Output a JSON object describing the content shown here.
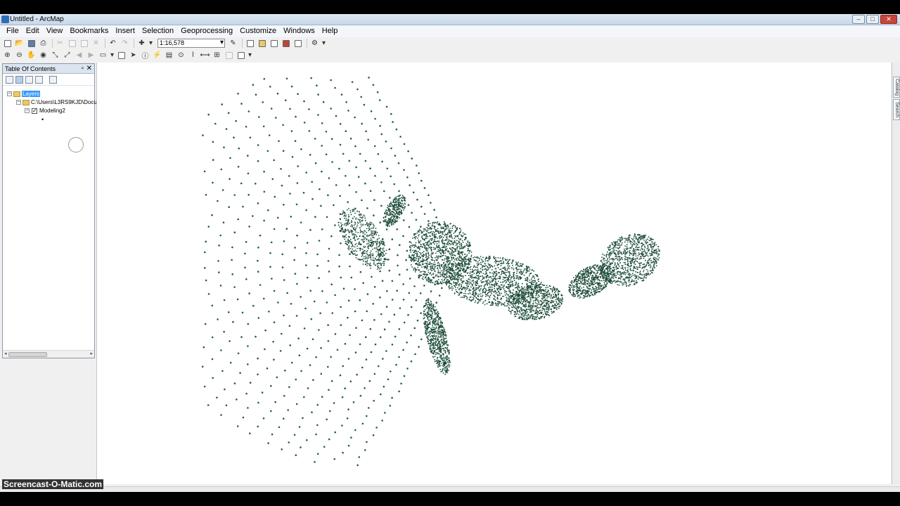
{
  "window": {
    "title": "Untitled - ArcMap"
  },
  "menu": [
    "File",
    "Edit",
    "View",
    "Bookmarks",
    "Insert",
    "Selection",
    "Geoprocessing",
    "Customize",
    "Windows",
    "Help"
  ],
  "toolbar": {
    "scale_value": "1:16,578"
  },
  "toc": {
    "title": "Table Of Contents",
    "root_label": "Layers",
    "folder_label": "C:\\Users\\L3RS9KJD\\Docu",
    "layer_label": "Modeling2",
    "layer_checked": true
  },
  "right_dock": {
    "tabs": [
      "Catalog",
      "Search"
    ]
  },
  "map": {
    "point_color": "#245e47",
    "dense_color": "#1e4d3a"
  },
  "watermark": "Screencast-O-Matic.com"
}
